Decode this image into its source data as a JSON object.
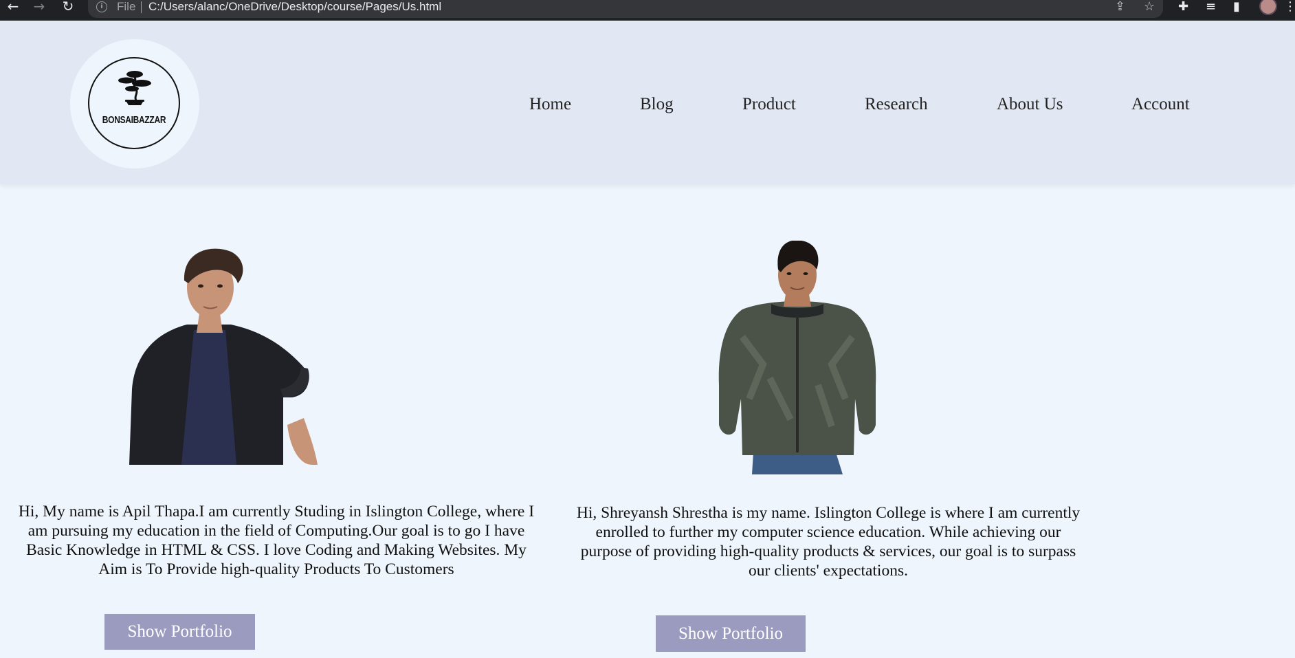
{
  "browser": {
    "back_icon": "←",
    "forward_icon": "→",
    "reload_icon": "↻",
    "info_icon": "i",
    "scheme": "File",
    "url": "C:/Users/alanc/OneDrive/Desktop/course/Pages/Us.html",
    "share_icon": "⇪",
    "star_icon": "☆",
    "extensions_icon": "✚",
    "media_icon": "≡",
    "sidepanel_icon": "▮",
    "menu_icon": "⋮"
  },
  "logo": {
    "text": "BONSAIBAZZAR"
  },
  "nav": {
    "items": [
      "Home",
      "Blog",
      "Product",
      "Research",
      "About Us",
      "Account"
    ]
  },
  "members": [
    {
      "bio": "Hi, My name is Apil Thapa.I am currently Studing in Islington College, where I am pursuing my education in the field of Computing.Our goal is to go I have Basic Knowledge in HTML & CSS. I love Coding and Making Websites. My Aim is To Provide high-quality Products To Customers",
      "button": "Show Portfolio"
    },
    {
      "bio": "Hi, Shreyansh Shrestha is my name. Islington College is where I am currently enrolled to further my computer science education. While achieving our purpose of providing high-quality products & services, our goal is to surpass our clients' expectations.",
      "button": "Show Portfolio"
    }
  ],
  "colors": {
    "page_bg": "#eef5fc",
    "header_bg": "#e2e8f3",
    "button_bg": "#9a9bbf",
    "chrome_bg": "#202124"
  }
}
